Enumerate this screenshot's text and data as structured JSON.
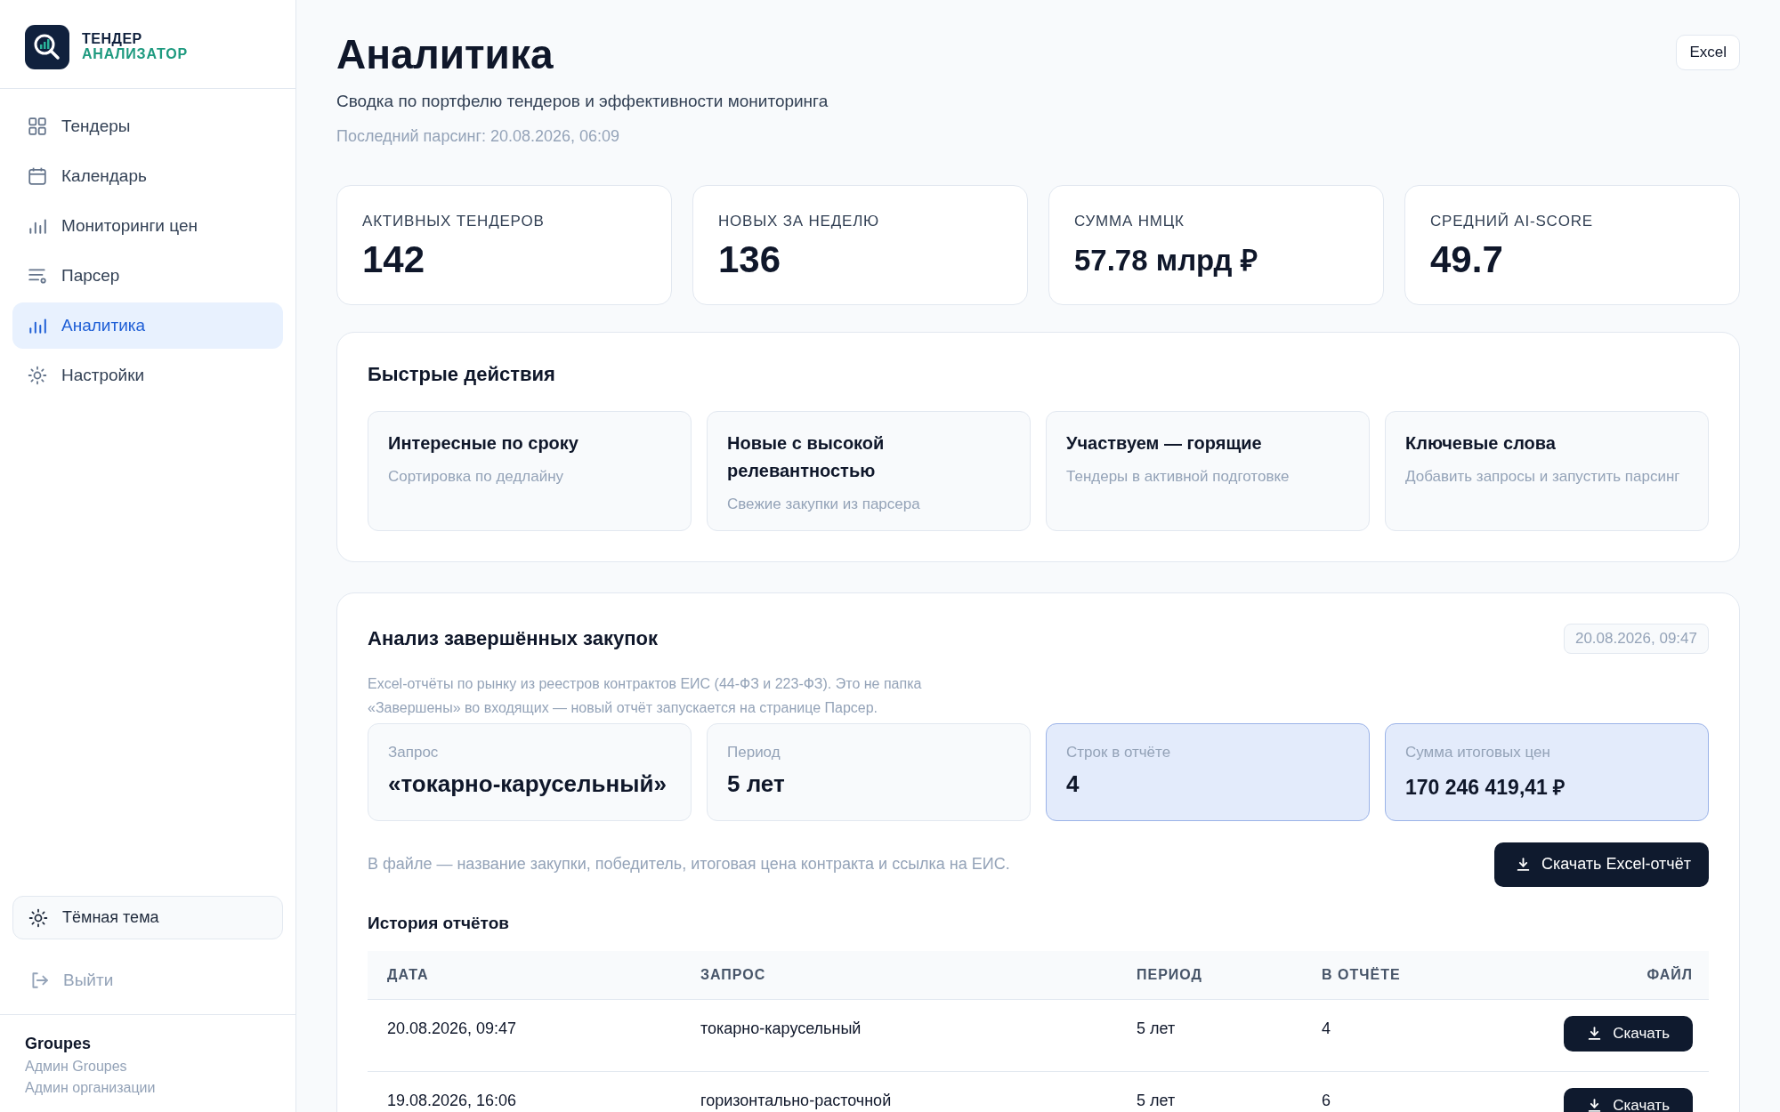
{
  "sidebar": {
    "logo": {
      "line1": "ТЕНДЕР",
      "line2": "АНАЛИЗАТОР"
    },
    "nav": [
      {
        "label": "Тендеры",
        "kind": "grid",
        "selected": false
      },
      {
        "label": "Календарь",
        "kind": "calendar",
        "selected": false
      },
      {
        "label": "Мониторинги цен",
        "kind": "bars",
        "selected": false
      },
      {
        "label": "Парсер",
        "kind": "list",
        "selected": false
      },
      {
        "label": "Аналитика",
        "kind": "bars",
        "selected": true
      },
      {
        "label": "Настройки",
        "kind": "sun",
        "selected": false
      }
    ],
    "theme_toggle": "Тёмная тема",
    "logout": "Выйти",
    "org": {
      "name": "Groupes",
      "roles": [
        "Админ Groupes",
        "Админ организации"
      ]
    }
  },
  "header": {
    "title": "Аналитика",
    "subtitle": "Сводка по портфелю тендеров и эффективности мониторинга",
    "last_parse": "Последний парсинг: 20.08.2026, 06:09",
    "export_button": "Excel"
  },
  "stats": [
    {
      "label": "АКТИВНЫХ ТЕНДЕРОВ",
      "value": "142",
      "kind": "count"
    },
    {
      "label": "НОВЫХ ЗА НЕДЕЛЮ",
      "value": "136",
      "kind": "count"
    },
    {
      "label": "СУММА НМЦК",
      "value": "57.78 млрд ₽",
      "kind": "money"
    },
    {
      "label": "СРЕДНИЙ AI-SCORE",
      "value": "49.7",
      "kind": "count"
    }
  ],
  "quick_actions": {
    "title": "Быстрые действия",
    "items": [
      {
        "title": "Интересные по сроку",
        "subtitle": "Сортировка по дедлайну"
      },
      {
        "title": "Новые с высокой релевантностью",
        "subtitle": "Свежие закупки из парсера"
      },
      {
        "title": "Участвуем — горящие",
        "subtitle": "Тендеры в активной подготовке"
      },
      {
        "title": "Ключевые слова",
        "subtitle": "Добавить запросы и запустить парсинг"
      }
    ]
  },
  "analysis": {
    "title": "Анализ завершённых закупок",
    "timestamp": "20.08.2026, 09:47",
    "description": "Excel-отчёты по рынку из реестров контрактов ЕИС (44-ФЗ и 223-ФЗ). Это не папка «Завершены» во входящих — новый отчёт запускается на странице Парсер.",
    "metrics": [
      {
        "label": "Запрос",
        "value": "«токарно-карусельный»",
        "highlighted": false
      },
      {
        "label": "Период",
        "value": "5 лет",
        "highlighted": false
      },
      {
        "label": "Строк в отчёте",
        "value": "4",
        "highlighted": true
      },
      {
        "label": "Сумма итоговых цен",
        "value": "170 246 419,41 ₽",
        "highlighted": true
      }
    ],
    "note": "В файле — название закупки, победитель, итоговая цена контракта и ссылка на ЕИС.",
    "download_button": "Скачать Excel-отчёт",
    "history": {
      "title": "История отчётов",
      "columns": [
        "ДАТА",
        "ЗАПРОС",
        "ПЕРИОД",
        "В ОТЧЁТЕ",
        "ФАЙЛ"
      ],
      "rows": [
        {
          "date": "20.08.2026, 09:47",
          "query": "токарно-карусельный",
          "period": "5 лет",
          "count": "4",
          "action": "Скачать"
        },
        {
          "date": "19.08.2026, 16:06",
          "query": "горизонтально-расточной",
          "period": "5 лет",
          "count": "6",
          "action": "Скачать"
        }
      ]
    }
  }
}
